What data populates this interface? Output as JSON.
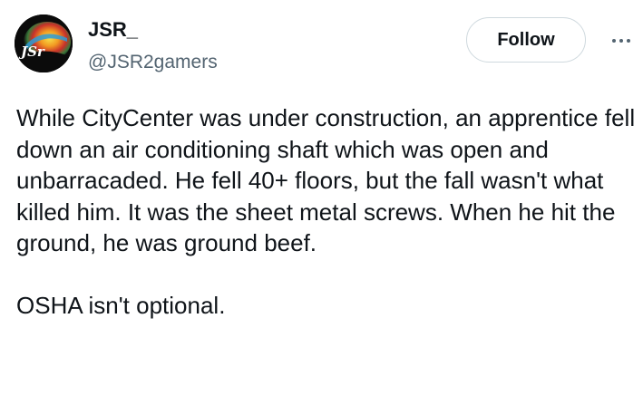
{
  "author": {
    "display_name": "JSR_",
    "handle": "@JSR2gamers",
    "avatar_text": "JSr"
  },
  "actions": {
    "follow_label": "Follow",
    "more_icon": "more-horizontal-icon"
  },
  "tweet": {
    "paragraph_1": "While CityCenter was under construction, an apprentice fell down an air conditioning shaft which was open and unbarracaded. He fell 40+ floors, but the fall wasn't what killed him. It was the sheet metal screws. When he hit the ground, he was ground beef.",
    "paragraph_2": "OSHA isn't optional."
  },
  "colors": {
    "text_primary": "#0f1419",
    "text_secondary": "#536471",
    "border": "#cfd9de",
    "background": "#ffffff"
  }
}
